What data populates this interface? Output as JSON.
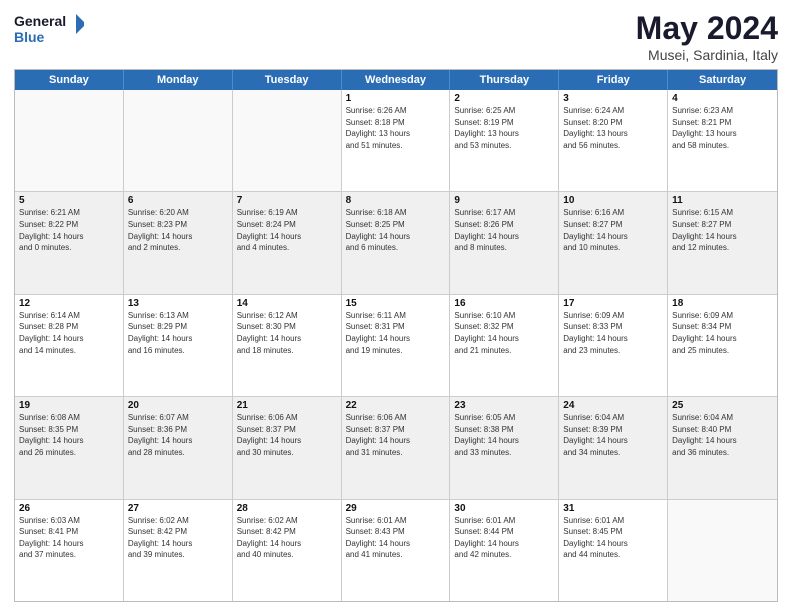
{
  "header": {
    "logo_line1": "General",
    "logo_line2": "Blue",
    "title": "May 2024",
    "subtitle": "Musei, Sardinia, Italy"
  },
  "calendar": {
    "days_of_week": [
      "Sunday",
      "Monday",
      "Tuesday",
      "Wednesday",
      "Thursday",
      "Friday",
      "Saturday"
    ],
    "rows": [
      [
        {
          "day": "",
          "empty": true,
          "content": ""
        },
        {
          "day": "",
          "empty": true,
          "content": ""
        },
        {
          "day": "",
          "empty": true,
          "content": ""
        },
        {
          "day": "1",
          "empty": false,
          "shaded": false,
          "content": "Sunrise: 6:26 AM\nSunset: 8:18 PM\nDaylight: 13 hours\nand 51 minutes."
        },
        {
          "day": "2",
          "empty": false,
          "shaded": false,
          "content": "Sunrise: 6:25 AM\nSunset: 8:19 PM\nDaylight: 13 hours\nand 53 minutes."
        },
        {
          "day": "3",
          "empty": false,
          "shaded": false,
          "content": "Sunrise: 6:24 AM\nSunset: 8:20 PM\nDaylight: 13 hours\nand 56 minutes."
        },
        {
          "day": "4",
          "empty": false,
          "shaded": false,
          "content": "Sunrise: 6:23 AM\nSunset: 8:21 PM\nDaylight: 13 hours\nand 58 minutes."
        }
      ],
      [
        {
          "day": "5",
          "empty": false,
          "shaded": true,
          "content": "Sunrise: 6:21 AM\nSunset: 8:22 PM\nDaylight: 14 hours\nand 0 minutes."
        },
        {
          "day": "6",
          "empty": false,
          "shaded": true,
          "content": "Sunrise: 6:20 AM\nSunset: 8:23 PM\nDaylight: 14 hours\nand 2 minutes."
        },
        {
          "day": "7",
          "empty": false,
          "shaded": true,
          "content": "Sunrise: 6:19 AM\nSunset: 8:24 PM\nDaylight: 14 hours\nand 4 minutes."
        },
        {
          "day": "8",
          "empty": false,
          "shaded": true,
          "content": "Sunrise: 6:18 AM\nSunset: 8:25 PM\nDaylight: 14 hours\nand 6 minutes."
        },
        {
          "day": "9",
          "empty": false,
          "shaded": true,
          "content": "Sunrise: 6:17 AM\nSunset: 8:26 PM\nDaylight: 14 hours\nand 8 minutes."
        },
        {
          "day": "10",
          "empty": false,
          "shaded": true,
          "content": "Sunrise: 6:16 AM\nSunset: 8:27 PM\nDaylight: 14 hours\nand 10 minutes."
        },
        {
          "day": "11",
          "empty": false,
          "shaded": true,
          "content": "Sunrise: 6:15 AM\nSunset: 8:27 PM\nDaylight: 14 hours\nand 12 minutes."
        }
      ],
      [
        {
          "day": "12",
          "empty": false,
          "shaded": false,
          "content": "Sunrise: 6:14 AM\nSunset: 8:28 PM\nDaylight: 14 hours\nand 14 minutes."
        },
        {
          "day": "13",
          "empty": false,
          "shaded": false,
          "content": "Sunrise: 6:13 AM\nSunset: 8:29 PM\nDaylight: 14 hours\nand 16 minutes."
        },
        {
          "day": "14",
          "empty": false,
          "shaded": false,
          "content": "Sunrise: 6:12 AM\nSunset: 8:30 PM\nDaylight: 14 hours\nand 18 minutes."
        },
        {
          "day": "15",
          "empty": false,
          "shaded": false,
          "content": "Sunrise: 6:11 AM\nSunset: 8:31 PM\nDaylight: 14 hours\nand 19 minutes."
        },
        {
          "day": "16",
          "empty": false,
          "shaded": false,
          "content": "Sunrise: 6:10 AM\nSunset: 8:32 PM\nDaylight: 14 hours\nand 21 minutes."
        },
        {
          "day": "17",
          "empty": false,
          "shaded": false,
          "content": "Sunrise: 6:09 AM\nSunset: 8:33 PM\nDaylight: 14 hours\nand 23 minutes."
        },
        {
          "day": "18",
          "empty": false,
          "shaded": false,
          "content": "Sunrise: 6:09 AM\nSunset: 8:34 PM\nDaylight: 14 hours\nand 25 minutes."
        }
      ],
      [
        {
          "day": "19",
          "empty": false,
          "shaded": true,
          "content": "Sunrise: 6:08 AM\nSunset: 8:35 PM\nDaylight: 14 hours\nand 26 minutes."
        },
        {
          "day": "20",
          "empty": false,
          "shaded": true,
          "content": "Sunrise: 6:07 AM\nSunset: 8:36 PM\nDaylight: 14 hours\nand 28 minutes."
        },
        {
          "day": "21",
          "empty": false,
          "shaded": true,
          "content": "Sunrise: 6:06 AM\nSunset: 8:37 PM\nDaylight: 14 hours\nand 30 minutes."
        },
        {
          "day": "22",
          "empty": false,
          "shaded": true,
          "content": "Sunrise: 6:06 AM\nSunset: 8:37 PM\nDaylight: 14 hours\nand 31 minutes."
        },
        {
          "day": "23",
          "empty": false,
          "shaded": true,
          "content": "Sunrise: 6:05 AM\nSunset: 8:38 PM\nDaylight: 14 hours\nand 33 minutes."
        },
        {
          "day": "24",
          "empty": false,
          "shaded": true,
          "content": "Sunrise: 6:04 AM\nSunset: 8:39 PM\nDaylight: 14 hours\nand 34 minutes."
        },
        {
          "day": "25",
          "empty": false,
          "shaded": true,
          "content": "Sunrise: 6:04 AM\nSunset: 8:40 PM\nDaylight: 14 hours\nand 36 minutes."
        }
      ],
      [
        {
          "day": "26",
          "empty": false,
          "shaded": false,
          "content": "Sunrise: 6:03 AM\nSunset: 8:41 PM\nDaylight: 14 hours\nand 37 minutes."
        },
        {
          "day": "27",
          "empty": false,
          "shaded": false,
          "content": "Sunrise: 6:02 AM\nSunset: 8:42 PM\nDaylight: 14 hours\nand 39 minutes."
        },
        {
          "day": "28",
          "empty": false,
          "shaded": false,
          "content": "Sunrise: 6:02 AM\nSunset: 8:42 PM\nDaylight: 14 hours\nand 40 minutes."
        },
        {
          "day": "29",
          "empty": false,
          "shaded": false,
          "content": "Sunrise: 6:01 AM\nSunset: 8:43 PM\nDaylight: 14 hours\nand 41 minutes."
        },
        {
          "day": "30",
          "empty": false,
          "shaded": false,
          "content": "Sunrise: 6:01 AM\nSunset: 8:44 PM\nDaylight: 14 hours\nand 42 minutes."
        },
        {
          "day": "31",
          "empty": false,
          "shaded": false,
          "content": "Sunrise: 6:01 AM\nSunset: 8:45 PM\nDaylight: 14 hours\nand 44 minutes."
        },
        {
          "day": "",
          "empty": true,
          "content": ""
        }
      ]
    ]
  }
}
